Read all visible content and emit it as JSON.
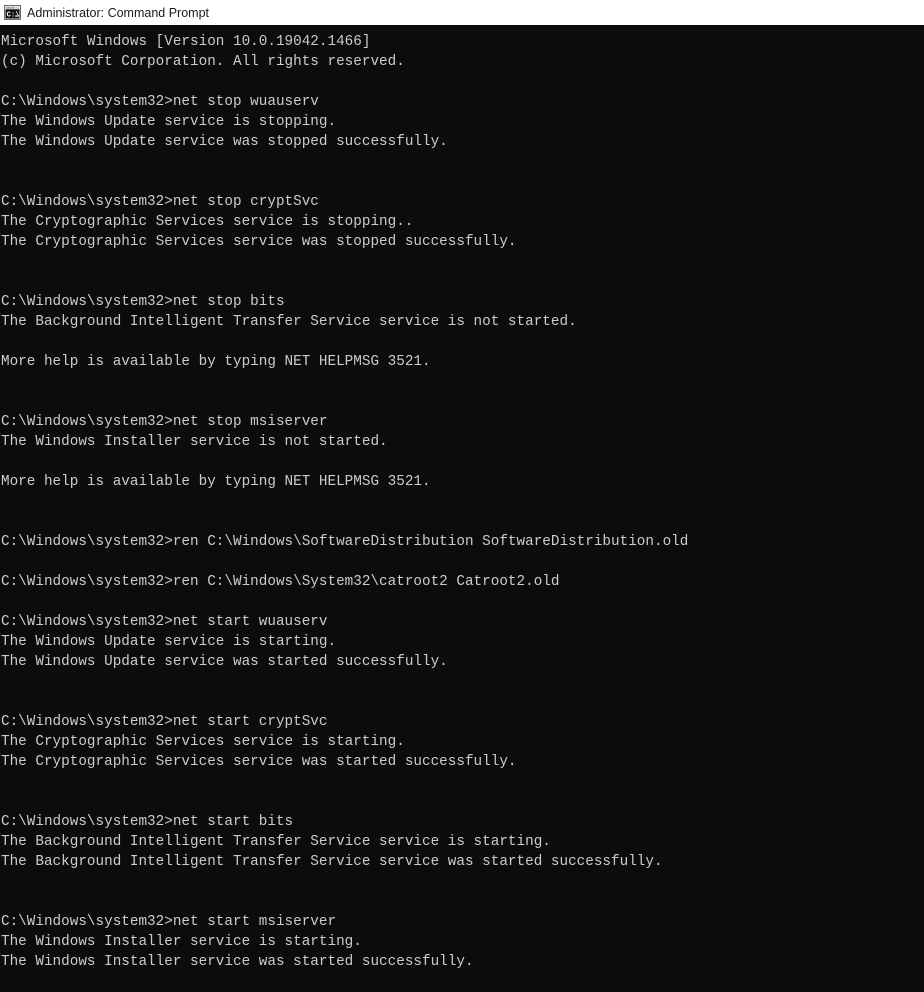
{
  "window": {
    "title": "Administrator: Command Prompt",
    "icon": "command-prompt-icon",
    "titlebar_bg": "#ffffff",
    "titlebar_fg": "#1a1a1a"
  },
  "console": {
    "background": "#0c0c0c",
    "foreground": "#cccccc",
    "prompt": "C:\\Windows\\system32>",
    "lines": [
      "Microsoft Windows [Version 10.0.19042.1466]",
      "(c) Microsoft Corporation. All rights reserved.",
      "",
      "C:\\Windows\\system32>net stop wuauserv",
      "The Windows Update service is stopping.",
      "The Windows Update service was stopped successfully.",
      "",
      "",
      "C:\\Windows\\system32>net stop cryptSvc",
      "The Cryptographic Services service is stopping..",
      "The Cryptographic Services service was stopped successfully.",
      "",
      "",
      "C:\\Windows\\system32>net stop bits",
      "The Background Intelligent Transfer Service service is not started.",
      "",
      "More help is available by typing NET HELPMSG 3521.",
      "",
      "",
      "C:\\Windows\\system32>net stop msiserver",
      "The Windows Installer service is not started.",
      "",
      "More help is available by typing NET HELPMSG 3521.",
      "",
      "",
      "C:\\Windows\\system32>ren C:\\Windows\\SoftwareDistribution SoftwareDistribution.old",
      "",
      "C:\\Windows\\system32>ren C:\\Windows\\System32\\catroot2 Catroot2.old",
      "",
      "C:\\Windows\\system32>net start wuauserv",
      "The Windows Update service is starting.",
      "The Windows Update service was started successfully.",
      "",
      "",
      "C:\\Windows\\system32>net start cryptSvc",
      "The Cryptographic Services service is starting.",
      "The Cryptographic Services service was started successfully.",
      "",
      "",
      "C:\\Windows\\system32>net start bits",
      "The Background Intelligent Transfer Service service is starting.",
      "The Background Intelligent Transfer Service service was started successfully.",
      "",
      "",
      "C:\\Windows\\system32>net start msiserver",
      "The Windows Installer service is starting.",
      "The Windows Installer service was started successfully."
    ]
  }
}
